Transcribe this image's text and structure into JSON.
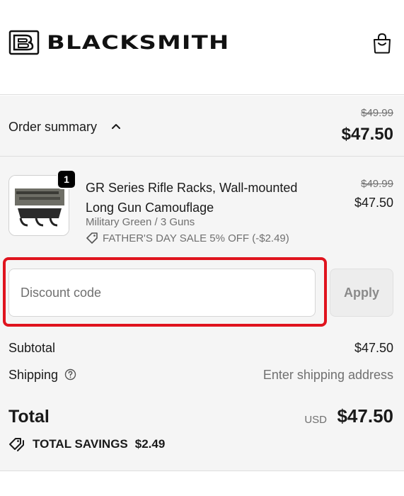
{
  "header": {
    "brand": "BLACKSMITH",
    "logo_icon": "bd-monogram-icon",
    "cart_icon": "shopping-bag-icon"
  },
  "summary_toggle": {
    "label": "Order summary",
    "icon": "chevron-up-icon",
    "compare_at_total": "$49.99",
    "total": "$47.50"
  },
  "line_items": [
    {
      "quantity": "1",
      "title": "GR Series Rifle Racks, Wall-mounted Long Gun Camouflage",
      "variant": "Military Green / 3 Guns",
      "discount": "FATHER'S DAY SALE 5% OFF (-$2.49)",
      "compare_at_price": "$49.99",
      "price": "$47.50"
    }
  ],
  "discount": {
    "placeholder": "Discount code",
    "apply_label": "Apply"
  },
  "costs": {
    "subtotal_label": "Subtotal",
    "subtotal_value": "$47.50",
    "shipping_label": "Shipping",
    "shipping_value": "Enter shipping address",
    "total_label": "Total",
    "currency": "USD",
    "total_value": "$47.50"
  },
  "savings": {
    "label": "TOTAL SAVINGS",
    "amount": "$2.49"
  },
  "colors": {
    "highlight": "#e0141e",
    "background": "#f5f5f5"
  }
}
